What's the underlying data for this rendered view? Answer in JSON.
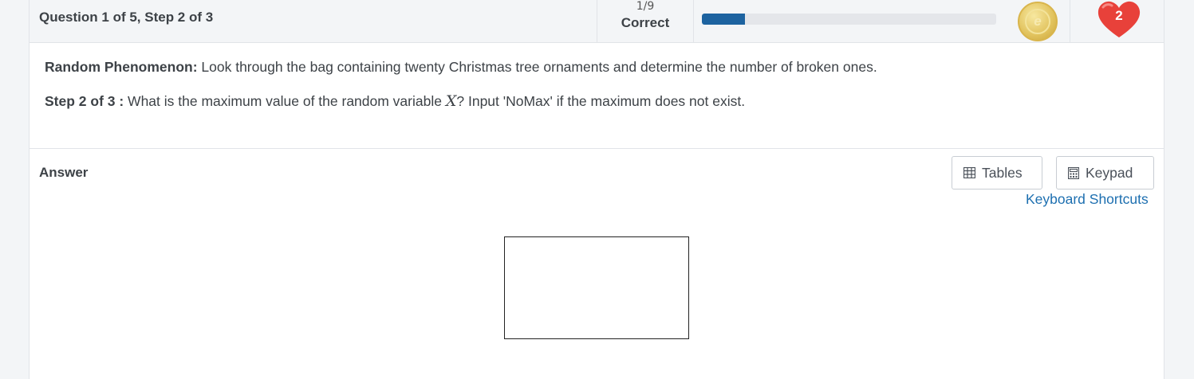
{
  "header": {
    "question_title": "Question 1 of 5, Step 2 of 3",
    "score_fraction": "1/9",
    "score_label": "Correct",
    "progress_fraction": 0.145,
    "lives_count": "2"
  },
  "question": {
    "phenomenon_label": "Random Phenomenon:",
    "phenomenon_text": " Look through the bag containing twenty Christmas tree ornaments and determine the number of broken ones.",
    "step_label": "Step 2 of 3 :",
    "step_text_before": " What is the maximum value of the random variable ",
    "step_variable": "X",
    "step_text_after": "? Input 'NoMax' if the maximum does not exist."
  },
  "answer": {
    "label": "Answer",
    "tables_label": "Tables",
    "keypad_label": "Keypad",
    "shortcuts_label": "Keyboard Shortcuts",
    "input_value": ""
  },
  "colors": {
    "progress_fill": "#1d63a0",
    "link": "#1d6fb0",
    "heart": "#e8413a",
    "coin": "#e1c25c"
  },
  "icons": {
    "coin": "achievement-coin-icon",
    "heart": "heart-icon",
    "tables": "table-grid-icon",
    "keypad": "calculator-icon"
  }
}
